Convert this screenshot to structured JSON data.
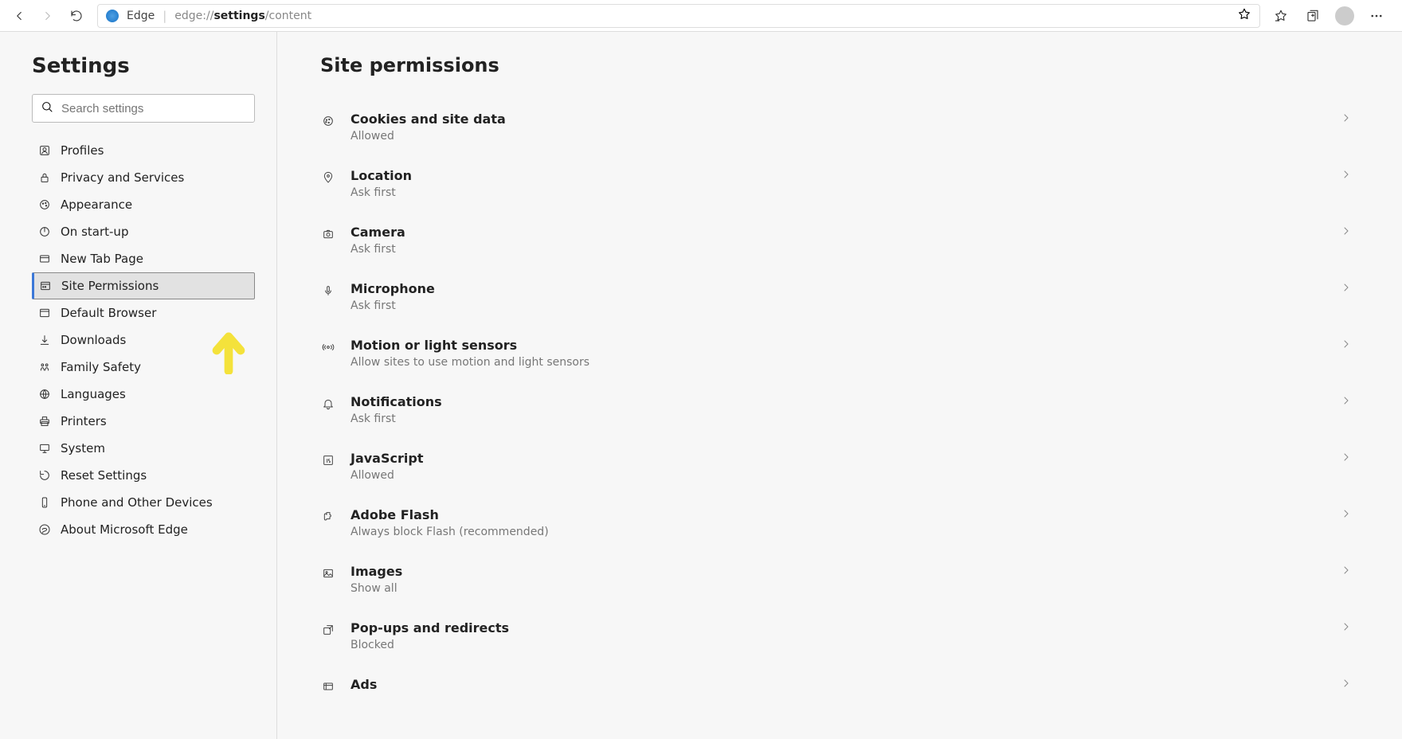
{
  "toolbar": {
    "label": "Edge",
    "url_prefix": "edge://",
    "url_bold": "settings",
    "url_suffix": "/content"
  },
  "sidebar": {
    "title": "Settings",
    "search_placeholder": "Search settings",
    "items": [
      {
        "icon": "profile",
        "label": "Profiles",
        "id": "profiles"
      },
      {
        "icon": "lock",
        "label": "Privacy and Services",
        "id": "privacy"
      },
      {
        "icon": "palette",
        "label": "Appearance",
        "id": "appearance"
      },
      {
        "icon": "power",
        "label": "On start-up",
        "id": "startup"
      },
      {
        "icon": "tab",
        "label": "New Tab Page",
        "id": "newtab"
      },
      {
        "icon": "site",
        "label": "Site Permissions",
        "id": "site-permissions",
        "active": true
      },
      {
        "icon": "browser",
        "label": "Default Browser",
        "id": "default-browser"
      },
      {
        "icon": "download",
        "label": "Downloads",
        "id": "downloads"
      },
      {
        "icon": "family",
        "label": "Family Safety",
        "id": "family"
      },
      {
        "icon": "lang",
        "label": "Languages",
        "id": "languages"
      },
      {
        "icon": "printer",
        "label": "Printers",
        "id": "printers"
      },
      {
        "icon": "system",
        "label": "System",
        "id": "system"
      },
      {
        "icon": "reset",
        "label": "Reset Settings",
        "id": "reset"
      },
      {
        "icon": "phone",
        "label": "Phone and Other Devices",
        "id": "phone"
      },
      {
        "icon": "about",
        "label": "About Microsoft Edge",
        "id": "about"
      }
    ]
  },
  "content": {
    "title": "Site permissions",
    "items": [
      {
        "icon": "cookie",
        "title": "Cookies and site data",
        "sub": "Allowed",
        "id": "cookies"
      },
      {
        "icon": "location",
        "title": "Location",
        "sub": "Ask first",
        "id": "location"
      },
      {
        "icon": "camera",
        "title": "Camera",
        "sub": "Ask first",
        "id": "camera"
      },
      {
        "icon": "mic",
        "title": "Microphone",
        "sub": "Ask first",
        "id": "microphone"
      },
      {
        "icon": "motion",
        "title": "Motion or light sensors",
        "sub": "Allow sites to use motion and light sensors",
        "id": "motion"
      },
      {
        "icon": "bell",
        "title": "Notifications",
        "sub": "Ask first",
        "id": "notifications"
      },
      {
        "icon": "js",
        "title": "JavaScript",
        "sub": "Allowed",
        "id": "javascript"
      },
      {
        "icon": "puzzle",
        "title": "Adobe Flash",
        "sub": "Always block Flash (recommended)",
        "id": "flash"
      },
      {
        "icon": "image",
        "title": "Images",
        "sub": "Show all",
        "id": "images"
      },
      {
        "icon": "popup",
        "title": "Pop-ups and redirects",
        "sub": "Blocked",
        "id": "popups"
      },
      {
        "icon": "ads",
        "title": "Ads",
        "sub": "",
        "id": "ads"
      }
    ]
  }
}
